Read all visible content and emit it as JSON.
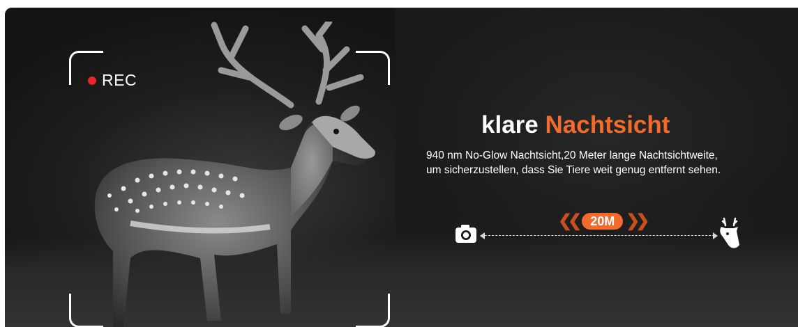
{
  "recording": {
    "label": "REC",
    "dot_color": "#e8262b"
  },
  "headline": {
    "white": "klare",
    "orange": "Nachtsicht",
    "accent_color": "#f26b2d"
  },
  "description": {
    "line1": "940 nm No-Glow Nachtsicht,20 Meter lange Nachtsichtweite,",
    "line2": "um sicherzustellen, dass Sie Tiere weit genug entfernt sehen."
  },
  "distance": {
    "badge": "20M",
    "left_icon": "camera-icon",
    "right_icon": "deer-head-icon"
  }
}
